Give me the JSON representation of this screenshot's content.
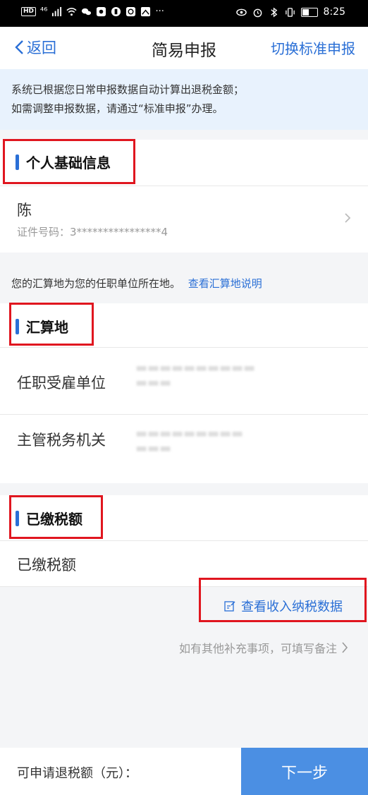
{
  "status_bar": {
    "hd_badge": "HD",
    "signal": "⁴⁶",
    "time": "8:25",
    "more": "···"
  },
  "nav": {
    "back_label": "返回",
    "title": "简易申报",
    "switch_label": "切换标准申报"
  },
  "banner": {
    "line1": "系统已根据您日常申报数据自动计算出退税金额；",
    "line2": "如需调整申报数据，请通过“标准申报”办理。"
  },
  "personal": {
    "section_title": "个人基础信息",
    "name": "陈",
    "id_label": "证件号码：3****************4"
  },
  "location_note": {
    "text": "您的汇算地为您的任职单位所在地。",
    "link": "查看汇算地说明"
  },
  "settlement": {
    "section_title": "汇算地",
    "employer_label": "任职受雇单位",
    "tax_office_label": "主管税务机关"
  },
  "paid_tax": {
    "section_title": "已缴税额",
    "row_label": "已缴税额",
    "view_link": "查看收入纳税数据"
  },
  "remarks": {
    "text": "如有其他补充事项，可填写备注"
  },
  "footer": {
    "refund_label": "可申请退税额（元）：",
    "next_button": "下一步"
  },
  "colors": {
    "accent": "#2a6fd6",
    "highlight_box": "#e0161f",
    "banner_bg": "#e8f2fd",
    "button_bg": "#4b8fe3"
  }
}
